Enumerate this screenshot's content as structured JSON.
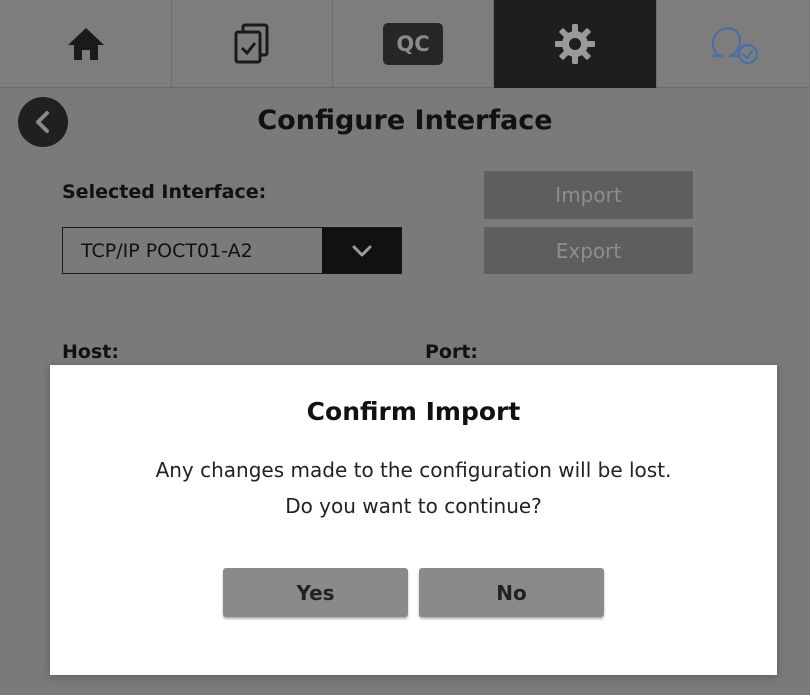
{
  "nav": {
    "tabs": [
      {
        "icon": "home-icon"
      },
      {
        "icon": "checklist-icon"
      },
      {
        "icon": "qc-icon",
        "label": "QC"
      },
      {
        "icon": "gear-icon",
        "active": true
      },
      {
        "icon": "user-check-icon"
      }
    ]
  },
  "page": {
    "title": "Configure Interface",
    "selected_interface_label": "Selected Interface:",
    "selected_interface_value": "TCP/IP POCT01-A2",
    "import_label": "Import",
    "export_label": "Export",
    "host_label": "Host:",
    "port_label": "Port:"
  },
  "dialog": {
    "title": "Confirm Import",
    "message_line1": "Any changes made to the configuration will be lost.",
    "message_line2": "Do you want to continue?",
    "yes_label": "Yes",
    "no_label": "No"
  },
  "colors": {
    "overlay_bg": "#7a7a7a",
    "active_tab": "#1e1e1e",
    "dialog_bg": "#ffffff",
    "dialog_button": "#8a8a8a",
    "disabled_button": "#5e5e5e",
    "accent_icon": "#4a6fa5"
  }
}
